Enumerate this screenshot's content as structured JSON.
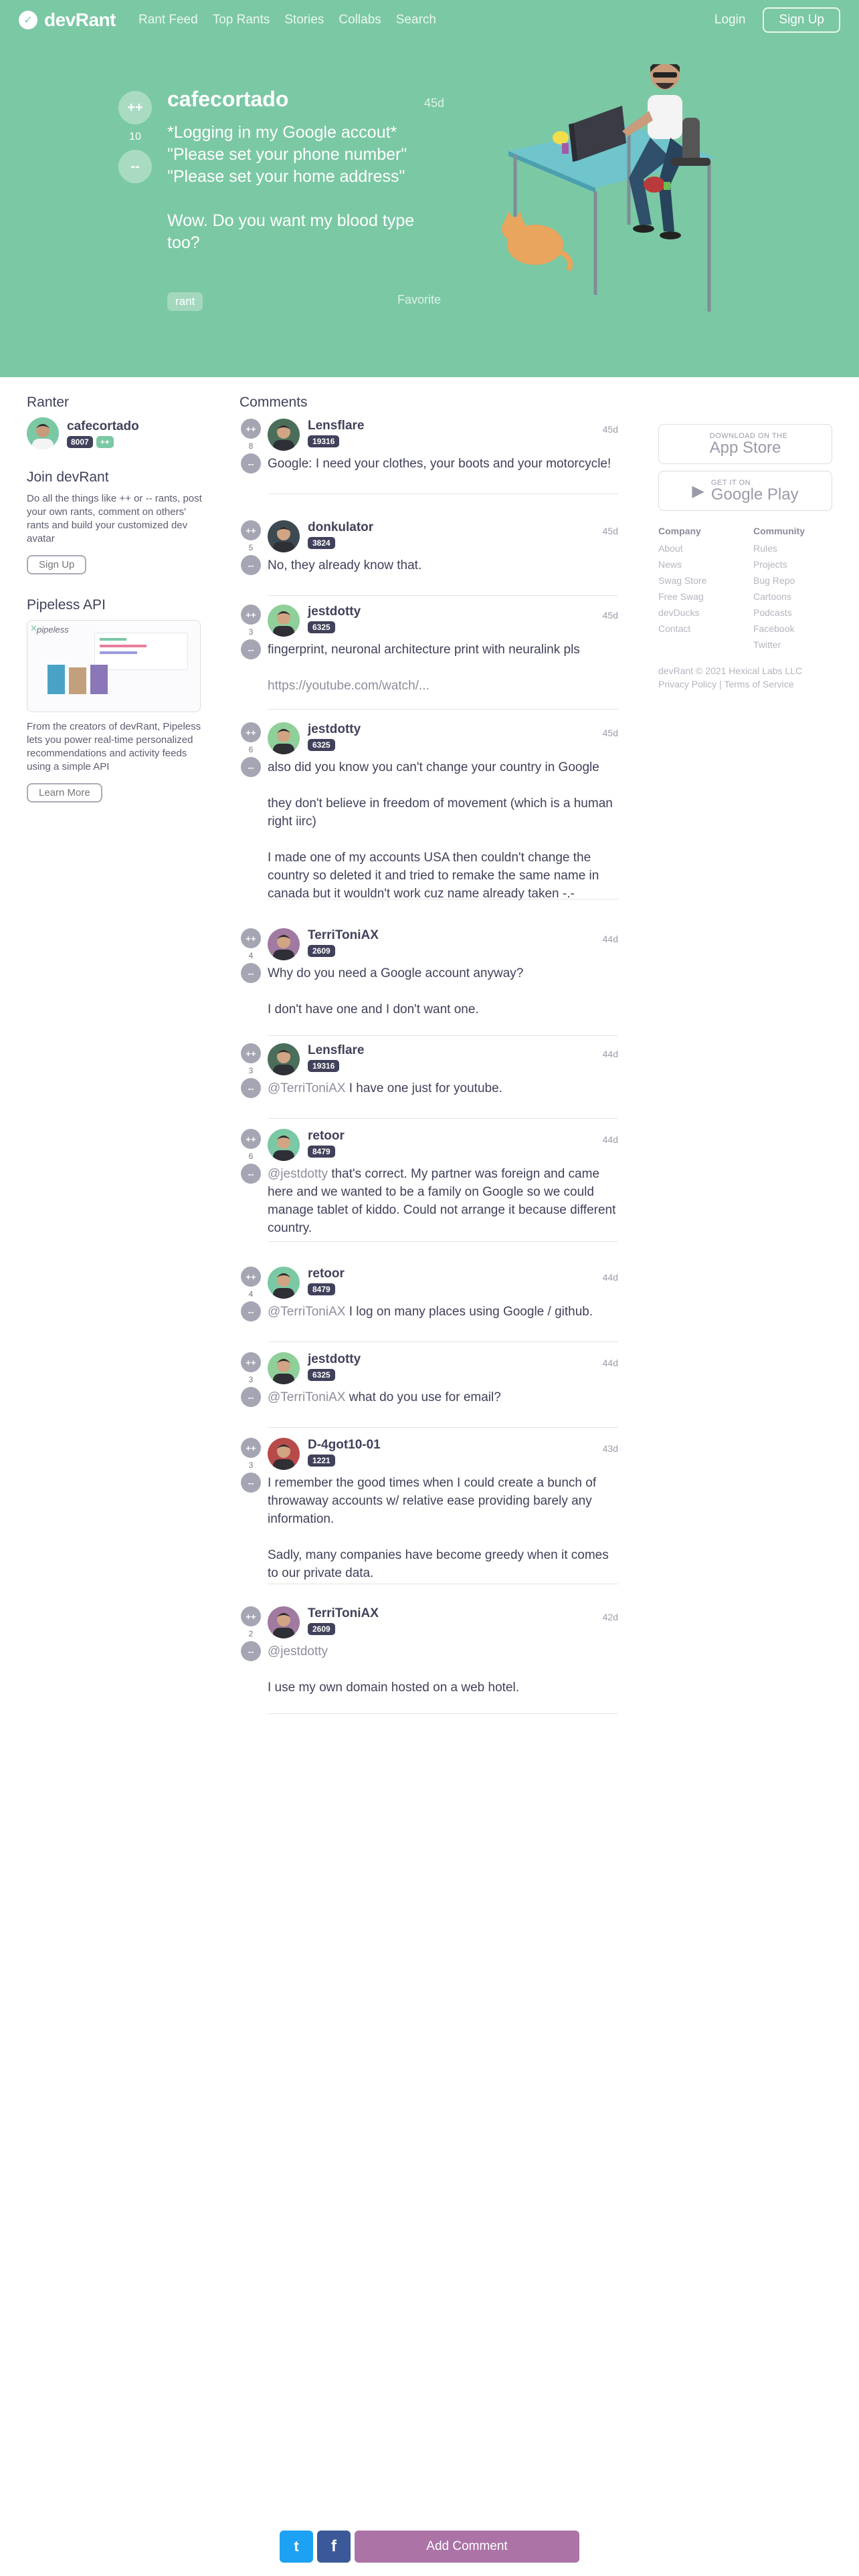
{
  "nav": {
    "logo": "devRant",
    "links": [
      "Rant Feed",
      "Top Rants",
      "Stories",
      "Collabs",
      "Search"
    ],
    "login": "Login",
    "signup": "Sign Up"
  },
  "rant": {
    "username": "cafecortado",
    "score": "10",
    "time": "45d",
    "lines": [
      "*Logging in my Google accout*",
      "\"Please set your phone number\"",
      "\"Please set your home address\"",
      "",
      "Wow. Do you want my blood type too?"
    ],
    "tag": "rant",
    "favorite": "Favorite",
    "upvote": "++",
    "downvote": "--"
  },
  "ranter": {
    "title": "Ranter",
    "username": "cafecortado",
    "score": "8007",
    "plus": "++"
  },
  "join": {
    "title": "Join devRant",
    "text": "Do all the things like ++ or -- rants, post your own rants, comment on others' rants and build your customized dev avatar",
    "button": "Sign Up"
  },
  "pipeless": {
    "title": "Pipeless API",
    "brand": "pipeless",
    "text": "From the creators of devRant, Pipeless lets you power real-time personalized recommendations and activity feeds using a simple API",
    "button": "Learn More"
  },
  "comments_title": "Comments",
  "comments": [
    {
      "user": "Lensflare",
      "score": "19316",
      "votes": "8",
      "time": "45d",
      "text": "Google: I need your clothes, your boots and your motorcycle!"
    },
    {
      "user": "donkulator",
      "score": "3824",
      "votes": "5",
      "time": "45d",
      "text": "No, they already know that."
    },
    {
      "user": "jestdotty",
      "score": "6325",
      "votes": "3",
      "time": "45d",
      "text": "fingerprint, neuronal architecture print with neuralink pls",
      "text2": "https://youtube.com/watch/..."
    },
    {
      "user": "jestdotty",
      "score": "6325",
      "votes": "6",
      "time": "45d",
      "text": "also did you know you can't change your country in Google\n\nthey don't believe in freedom of movement (which is a human right iirc)\n\nI made one of my accounts USA then couldn't change the country so deleted it and tried to remake the same name in canada but it wouldn't work cuz name already taken -.-"
    },
    {
      "user": "TerriToniAX",
      "score": "2609",
      "votes": "4",
      "time": "44d",
      "text": "Why do you need a Google account anyway?\n\nI don't have one and I don't want one."
    },
    {
      "user": "Lensflare",
      "score": "19316",
      "votes": "3",
      "time": "44d",
      "mention": "@TerriToniAX",
      "text": " I have one just for youtube."
    },
    {
      "user": "retoor",
      "score": "8479",
      "votes": "6",
      "time": "44d",
      "mention": "@jestdotty",
      "text": " that's correct. My partner was foreign and came here and we wanted to be a family on Google so we could manage tablet of kiddo. Could not arrange it because different country."
    },
    {
      "user": "retoor",
      "score": "8479",
      "votes": "4",
      "time": "44d",
      "mention": "@TerriToniAX",
      "text": " I log on many places using Google / github."
    },
    {
      "user": "jestdotty",
      "score": "6325",
      "votes": "3",
      "time": "44d",
      "mention": "@TerriToniAX",
      "text": " what do you use for email?"
    },
    {
      "user": "D-4got10-01",
      "score": "1221",
      "votes": "3",
      "time": "43d",
      "text": "I remember the good times when I could create a bunch of throwaway accounts w/ relative ease providing barely any information.\n\nSadly, many companies have become greedy when it comes to our private data."
    },
    {
      "user": "TerriToniAX",
      "score": "2609",
      "votes": "2",
      "time": "42d",
      "mention": "@jestdotty",
      "text": "\n\nI use my own domain hosted on a web hotel."
    }
  ],
  "stores": {
    "appstore_small": "Download on the",
    "appstore_big": "App Store",
    "play_small": "GET IT ON",
    "play_big": "Google Play"
  },
  "footer": {
    "company_title": "Company",
    "company": [
      "About",
      "News",
      "Swag Store",
      "Free Swag",
      "devDucks",
      "Contact"
    ],
    "community_title": "Community",
    "community": [
      "Rules",
      "Projects",
      "Bug Repo",
      "Cartoons",
      "Podcasts",
      "Facebook",
      "Twitter"
    ],
    "copyright": "devRant © 2021 Hexical Labs LLC",
    "privacy": "Privacy Policy",
    "sep": "|",
    "terms": "Terms of Service"
  },
  "bottom": {
    "twitter": "t",
    "facebook": "f",
    "add_comment": "Add Comment"
  },
  "colors": {
    "brand_green": "#7bc8a4",
    "dark": "#40415a",
    "add_comment": "#ab73a6",
    "twitter": "#1da1f2",
    "facebook": "#3b5998"
  }
}
